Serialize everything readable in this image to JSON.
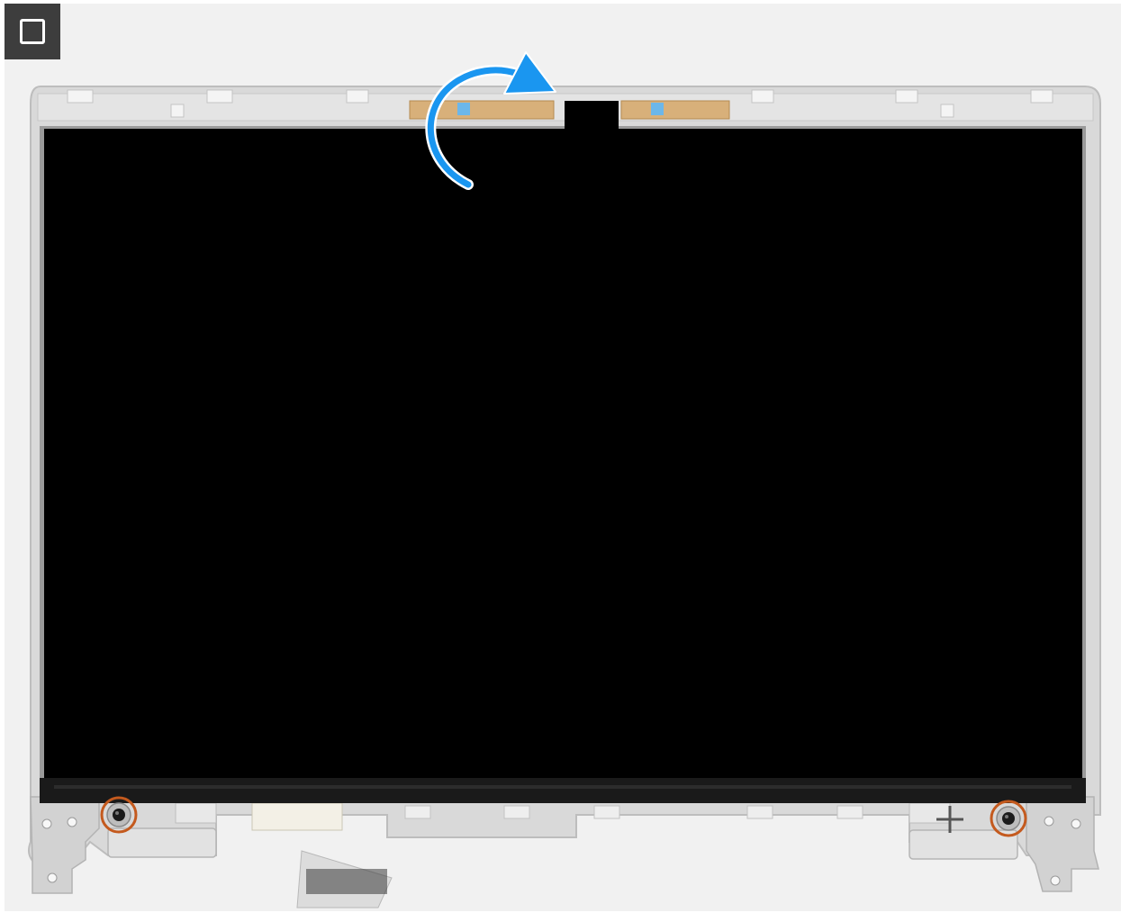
{
  "step_icon": "square-step-icon",
  "colors": {
    "background": "#f1f1f1",
    "frame": "#d9d9d9",
    "frame_edge": "#bdbdbd",
    "panel": "#000000",
    "arrow": "#1a96f0",
    "screw_highlight": "#c45a1e"
  },
  "icons": {
    "rotate_arrow": "curved-arrow-icon",
    "left_screw": "screw-icon",
    "right_screw": "screw-icon"
  }
}
